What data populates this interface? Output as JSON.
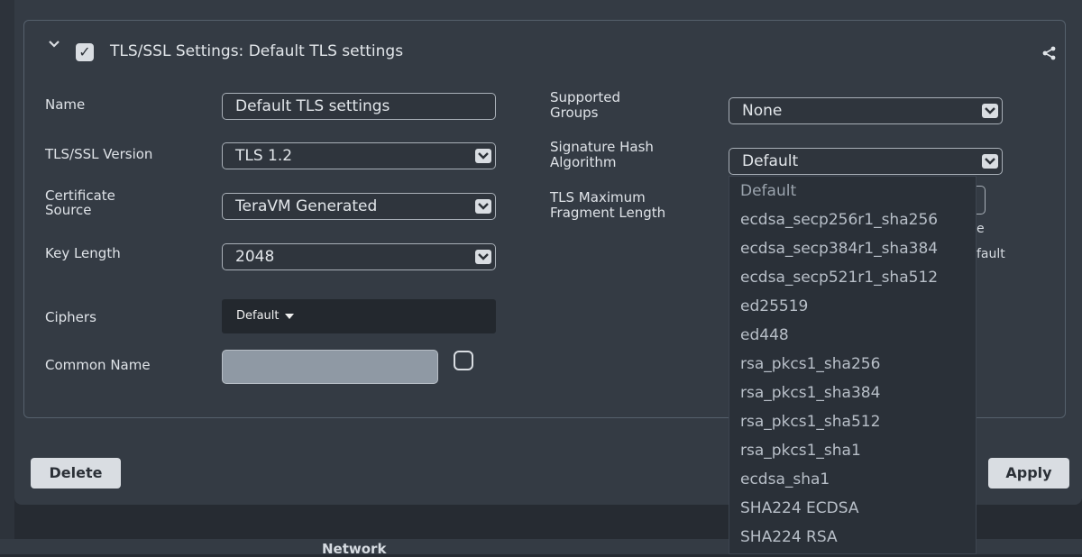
{
  "section": {
    "title": "TLS/SSL Settings: Default TLS settings",
    "enabled": true
  },
  "fields": {
    "name_label": "Name",
    "name_value": "Default TLS settings",
    "tls_version_label": "TLS/SSL Version",
    "tls_version_value": "TLS 1.2",
    "cert_source_label_1": "Certificate",
    "cert_source_label_2": "Source",
    "cert_source_value": "TeraVM Generated",
    "key_length_label": "Key Length",
    "key_length_value": "2048",
    "ciphers_label": "Ciphers",
    "ciphers_value": "Default",
    "common_name_label": "Common Name",
    "common_name_value": "",
    "supported_groups_label_1": "Supported",
    "supported_groups_label_2": "Groups",
    "supported_groups_value": "None",
    "sig_hash_label_1": "Signature Hash",
    "sig_hash_label_2": "Algorithm",
    "sig_hash_value": "Default",
    "tls_max_frag_label_1": "TLS Maximum",
    "tls_max_frag_label_2": "Fragment Length"
  },
  "partially_hidden": {
    "fragment_suffix_1": "e",
    "fragment_suffix_2": "fault"
  },
  "dropdown": {
    "options": [
      "Default",
      "ecdsa_secp256r1_sha256",
      "ecdsa_secp384r1_sha384",
      "ecdsa_secp521r1_sha512",
      "ed25519",
      "ed448",
      "rsa_pkcs1_sha256",
      "rsa_pkcs1_sha384",
      "rsa_pkcs1_sha512",
      "rsa_pkcs1_sha1",
      "ecdsa_sha1",
      "SHA224 ECDSA",
      "SHA224 RSA"
    ]
  },
  "buttons": {
    "delete": "Delete",
    "apply": "Apply"
  },
  "footer": {
    "partial_text": "Network"
  },
  "colors": {
    "background": "#262b32",
    "panel": "#343b44",
    "button": "#d9dde2"
  }
}
